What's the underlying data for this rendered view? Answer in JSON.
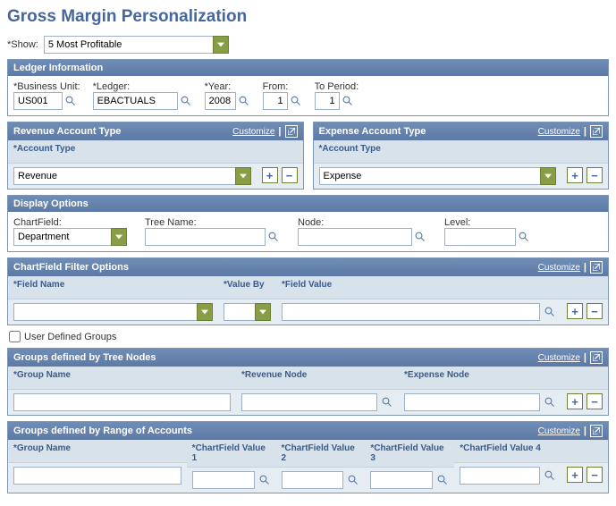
{
  "page_title": "Gross Margin Personalization",
  "show": {
    "label": "Show:",
    "value": "5 Most Profitable"
  },
  "ledger_info": {
    "title": "Ledger Information",
    "business_unit": {
      "label": "Business Unit:",
      "value": "US001"
    },
    "ledger": {
      "label": "Ledger:",
      "value": "EBACTUALS"
    },
    "year": {
      "label": "Year:",
      "value": "2008"
    },
    "from": {
      "label": "From:",
      "value": "1"
    },
    "to_period": {
      "label": "To Period:",
      "value": "1"
    }
  },
  "revenue_account": {
    "title": "Revenue Account Type",
    "customize": "Customize",
    "col_label": "Account Type",
    "value": "Revenue"
  },
  "expense_account": {
    "title": "Expense Account Type",
    "customize": "Customize",
    "col_label": "Account Type",
    "value": "Expense"
  },
  "display_options": {
    "title": "Display Options",
    "chartfield": {
      "label": "ChartField:",
      "value": "Department"
    },
    "tree_name": {
      "label": "Tree Name:",
      "value": ""
    },
    "node": {
      "label": "Node:",
      "value": ""
    },
    "level": {
      "label": "Level:",
      "value": ""
    }
  },
  "filter_options": {
    "title": "ChartField Filter Options",
    "customize": "Customize",
    "field_name": {
      "label": "Field Name",
      "value": ""
    },
    "value_by": {
      "label": "Value By",
      "value": ""
    },
    "field_value": {
      "label": "Field Value",
      "value": ""
    }
  },
  "user_defined_groups": {
    "label": "User Defined Groups",
    "checked": false
  },
  "groups_tree": {
    "title": "Groups defined by Tree Nodes",
    "customize": "Customize",
    "group_name": {
      "label": "Group Name",
      "value": ""
    },
    "revenue_node": {
      "label": "Revenue Node",
      "value": ""
    },
    "expense_node": {
      "label": "Expense Node",
      "value": ""
    }
  },
  "groups_range": {
    "title": "Groups defined by Range of Accounts",
    "customize": "Customize",
    "group_name": {
      "label": "Group Name",
      "value": ""
    },
    "cf1": {
      "label": "ChartField Value 1",
      "value": ""
    },
    "cf2": {
      "label": "ChartField Value 2",
      "value": ""
    },
    "cf3": {
      "label": "ChartField Value 3",
      "value": ""
    },
    "cf4": {
      "label": "ChartField Value 4",
      "value": ""
    }
  }
}
